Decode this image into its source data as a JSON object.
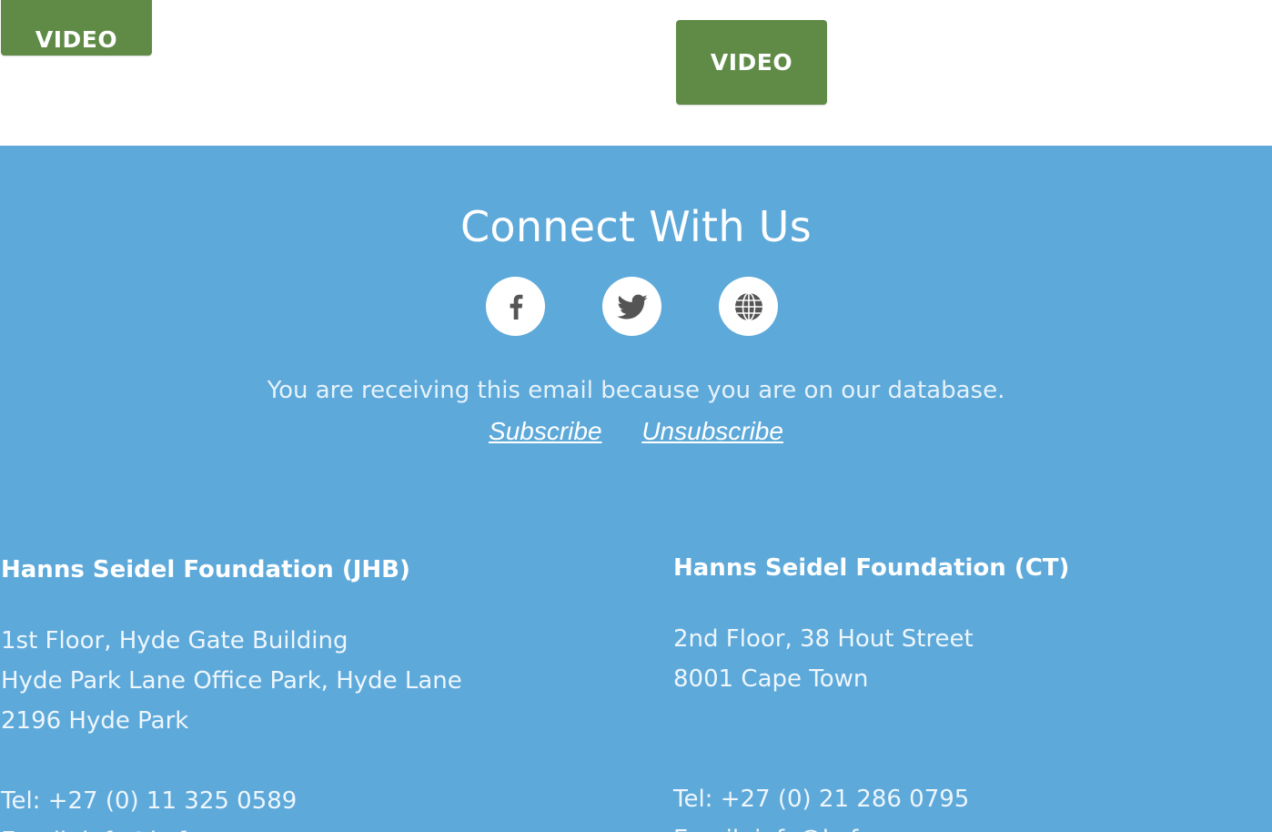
{
  "top_buttons": {
    "left_video_label": "VIDEO",
    "right_video_label": "VIDEO"
  },
  "footer": {
    "title": "Connect With Us",
    "social": [
      {
        "name": "facebook",
        "icon": "facebook-icon"
      },
      {
        "name": "twitter",
        "icon": "twitter-icon"
      },
      {
        "name": "website",
        "icon": "globe-icon"
      }
    ],
    "notice": "You are receiving this email because you are on our database.",
    "subscribe_label": "Subscribe",
    "unsubscribe_label": "Unsubscribe",
    "offices": {
      "jhb": {
        "name": "Hanns Seidel Foundation (JHB)",
        "address_line1": "1st Floor, Hyde Gate Building",
        "address_line2": "Hyde Park Lane Office Park, Hyde Lane",
        "address_line3": "2196 Hyde Park",
        "tel": "Tel: +27 (0) 11 325 0589",
        "email": "Email: info@hsf.co.za"
      },
      "ct": {
        "name": "Hanns Seidel Foundation (CT)",
        "address_line1": "2nd Floor, 38 Hout Street",
        "address_line2": "8001 Cape Town",
        "tel": "Tel: +27 (0) 21 286 0795",
        "email": "Email: info@hsf.co.za"
      }
    }
  },
  "colors": {
    "footer_bg": "#5da9da",
    "button_green": "#5f8b47",
    "icon_gray": "#555555"
  }
}
